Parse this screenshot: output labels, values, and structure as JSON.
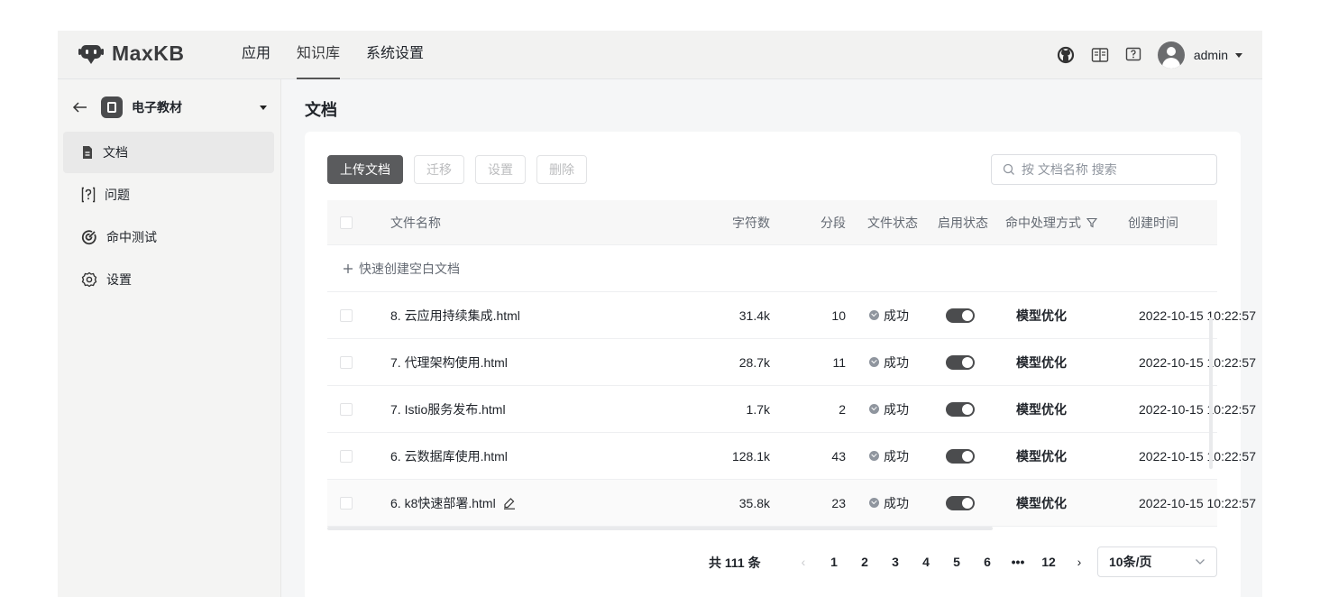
{
  "header": {
    "logo_text": "MaxKB",
    "nav": [
      {
        "label": "应用"
      },
      {
        "label": "知识库"
      },
      {
        "label": "系统设置"
      }
    ],
    "user_name": "admin",
    "icons": [
      "github-icon",
      "book-icon",
      "help-icon",
      "avatar"
    ]
  },
  "sidebar": {
    "knowledge_base_name": "电子教材",
    "items": [
      {
        "label": "文档",
        "icon": "document-icon"
      },
      {
        "label": "问题",
        "icon": "question-icon"
      },
      {
        "label": "命中测试",
        "icon": "target-icon"
      },
      {
        "label": "设置",
        "icon": "gear-icon"
      }
    ]
  },
  "main": {
    "title": "文档",
    "toolbar": {
      "upload": "上传文档",
      "migrate": "迁移",
      "settings": "设置",
      "delete": "删除"
    },
    "search": {
      "placeholder": "按 文档名称 搜索"
    },
    "table": {
      "headers": {
        "name": "文件名称",
        "chars": "字符数",
        "segments": "分段",
        "status": "文件状态",
        "enabled": "启用状态",
        "hit_mode": "命中处理方式",
        "created": "创建时间"
      },
      "create_blank": "快速创建空白文档",
      "rows": [
        {
          "name": "8. 云应用持续集成.html",
          "chars": "31.4k",
          "segments": "10",
          "status": "成功",
          "enabled": true,
          "hit_mode": "模型优化",
          "created": "2022-10-15 10:22:57"
        },
        {
          "name": "7. 代理架构使用.html",
          "chars": "28.7k",
          "segments": "11",
          "status": "成功",
          "enabled": true,
          "hit_mode": "模型优化",
          "created": "2022-10-15 10:22:57"
        },
        {
          "name": "7. Istio服务发布.html",
          "chars": "1.7k",
          "segments": "2",
          "status": "成功",
          "enabled": true,
          "hit_mode": "模型优化",
          "created": "2022-10-15 10:22:57"
        },
        {
          "name": "6. 云数据库使用.html",
          "chars": "128.1k",
          "segments": "43",
          "status": "成功",
          "enabled": true,
          "hit_mode": "模型优化",
          "created": "2022-10-15 10:22:57"
        },
        {
          "name": "6. k8快速部署.html",
          "chars": "35.8k",
          "segments": "23",
          "status": "成功",
          "enabled": true,
          "hit_mode": "模型优化",
          "created": "2022-10-15 10:22:57"
        }
      ]
    },
    "pagination": {
      "total": "共 111 条",
      "pages": [
        "1",
        "2",
        "3",
        "4",
        "5",
        "6",
        "•••",
        "12"
      ],
      "page_size": "10条/页"
    }
  }
}
